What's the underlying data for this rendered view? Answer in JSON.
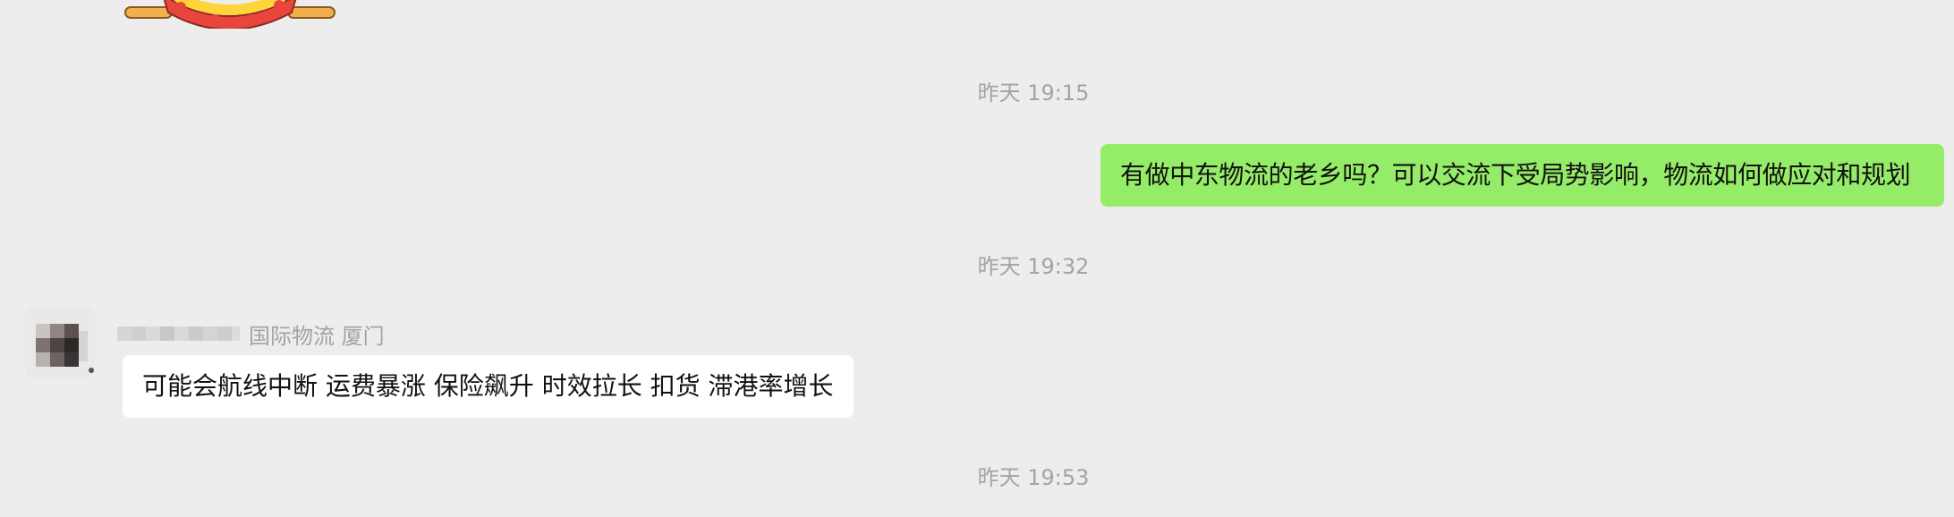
{
  "chat": {
    "timestamps": [
      "昨天 19:15",
      "昨天 19:32",
      "昨天 19:53"
    ],
    "messages": [
      {
        "direction": "outgoing",
        "text": "有做中东物流的老乡吗？可以交流下受局势影响，物流如何做应对和规划",
        "bubble_color": "#95ec69"
      },
      {
        "direction": "incoming",
        "sender_tag": "国际物流 厦门",
        "text": "可能会航线中断 运费暴涨 保险飙升 时效拉长 扣货 滞港率增长",
        "bubble_color": "#ffffff"
      }
    ]
  },
  "colors": {
    "background": "#ededed",
    "timestamp_text": "#a3a3a3"
  }
}
